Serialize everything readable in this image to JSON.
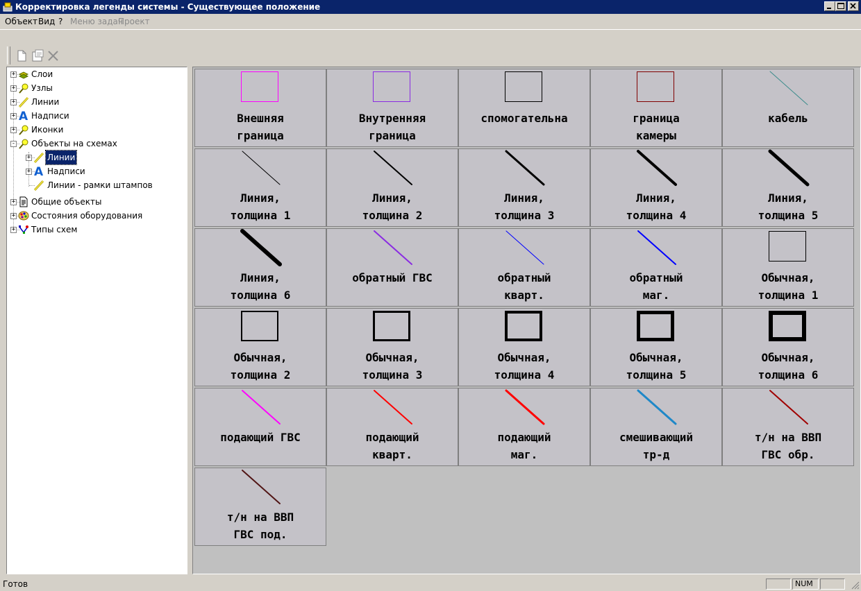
{
  "window": {
    "title": "Корректировка легенды системы - Существующее положение"
  },
  "menu": [
    {
      "label": "Объект",
      "enabled": true
    },
    {
      "label": "Вид",
      "enabled": true
    },
    {
      "label": "?",
      "enabled": true
    },
    {
      "label": "Меню задач",
      "enabled": false
    },
    {
      "label": "Проект",
      "enabled": false
    }
  ],
  "toolbar": {
    "buttons": [
      "new-document-icon",
      "properties-icon",
      "delete-icon"
    ]
  },
  "tree": [
    {
      "label": "Слои",
      "icon": "layers-icon",
      "expander": "+"
    },
    {
      "label": "Узлы",
      "icon": "node-icon",
      "expander": "+"
    },
    {
      "label": "Линии",
      "icon": "line-icon",
      "expander": "+"
    },
    {
      "label": "Надписи",
      "icon": "text-icon",
      "expander": "+"
    },
    {
      "label": "Иконки",
      "icon": "node-icon",
      "expander": "+"
    },
    {
      "label": "Объекты на схемах",
      "icon": "node-icon",
      "expander": "-"
    },
    {
      "label": "Линии",
      "icon": "line-icon",
      "expander": "+",
      "selected": true
    },
    {
      "label": "Надписи",
      "icon": "text-icon",
      "expander": "+"
    },
    {
      "label": "Линии - рамки штампов",
      "icon": "line-icon",
      "expander": ""
    },
    {
      "label": "Общие объекты",
      "icon": "document-icon",
      "expander": "+"
    },
    {
      "label": "Состояния оборудования",
      "icon": "palette-icon",
      "expander": "+"
    },
    {
      "label": "Типы схем",
      "icon": "diagram-types-icon",
      "expander": "+"
    }
  ],
  "legend_items": [
    {
      "label": "Внешняя\nграница",
      "shape": "rect",
      "color": "#ff00ff",
      "width": 1
    },
    {
      "label": "Внутренняя\nграница",
      "shape": "rect",
      "color": "#8a2be2",
      "width": 1
    },
    {
      "label": "спомогательна",
      "shape": "rect",
      "color": "#000000",
      "width": 1
    },
    {
      "label": "граница\nкамеры",
      "shape": "rect",
      "color": "#800000",
      "width": 1
    },
    {
      "label": "кабель",
      "shape": "line",
      "color": "#3c8c8c",
      "width": 1
    },
    {
      "label": "Линия,\nтолщина 1",
      "shape": "line",
      "color": "#000000",
      "width": 1
    },
    {
      "label": "Линия,\nтолщина 2",
      "shape": "line",
      "color": "#000000",
      "width": 2
    },
    {
      "label": "Линия,\nтолщина 3",
      "shape": "line",
      "color": "#000000",
      "width": 3
    },
    {
      "label": "Линия,\nтолщина 4",
      "shape": "line",
      "color": "#000000",
      "width": 4
    },
    {
      "label": "Линия,\nтолщина 5",
      "shape": "line",
      "color": "#000000",
      "width": 5
    },
    {
      "label": "Линия,\nтолщина 6",
      "shape": "line",
      "color": "#000000",
      "width": 6
    },
    {
      "label": "обратный ГВС",
      "shape": "line",
      "color": "#8a2be2",
      "width": 2
    },
    {
      "label": "обратный\nкварт.",
      "shape": "line",
      "color": "#0000ff",
      "width": 1
    },
    {
      "label": "обратный\nмаг.",
      "shape": "line",
      "color": "#0000ff",
      "width": 2
    },
    {
      "label": "Обычная,\nтолщина 1",
      "shape": "rect",
      "color": "#000000",
      "width": 1
    },
    {
      "label": "Обычная,\nтолщина 2",
      "shape": "rect",
      "color": "#000000",
      "width": 2
    },
    {
      "label": "Обычная,\nтолщина 3",
      "shape": "rect",
      "color": "#000000",
      "width": 3
    },
    {
      "label": "Обычная,\nтолщина 4",
      "shape": "rect",
      "color": "#000000",
      "width": 4
    },
    {
      "label": "Обычная,\nтолщина 5",
      "shape": "rect",
      "color": "#000000",
      "width": 5
    },
    {
      "label": "Обычная,\nтолщина 6",
      "shape": "rect",
      "color": "#000000",
      "width": 6
    },
    {
      "label": "подающий ГВС",
      "shape": "line",
      "color": "#ff00ff",
      "width": 2
    },
    {
      "label": "подающий\nкварт.",
      "shape": "line",
      "color": "#ff0000",
      "width": 2
    },
    {
      "label": "подающий\nмаг.",
      "shape": "line",
      "color": "#ff0000",
      "width": 3
    },
    {
      "label": "смешивающий\nтр-д",
      "shape": "line",
      "color": "#1e88c8",
      "width": 3
    },
    {
      "label": "т/н на ВВП\nГВС обр.",
      "shape": "line",
      "color": "#a00000",
      "width": 2
    },
    {
      "label": "т/н на ВВП\nГВС под.",
      "shape": "line",
      "color": "#501414",
      "width": 2
    }
  ],
  "status": {
    "text": "Готов",
    "num": "NUM"
  }
}
